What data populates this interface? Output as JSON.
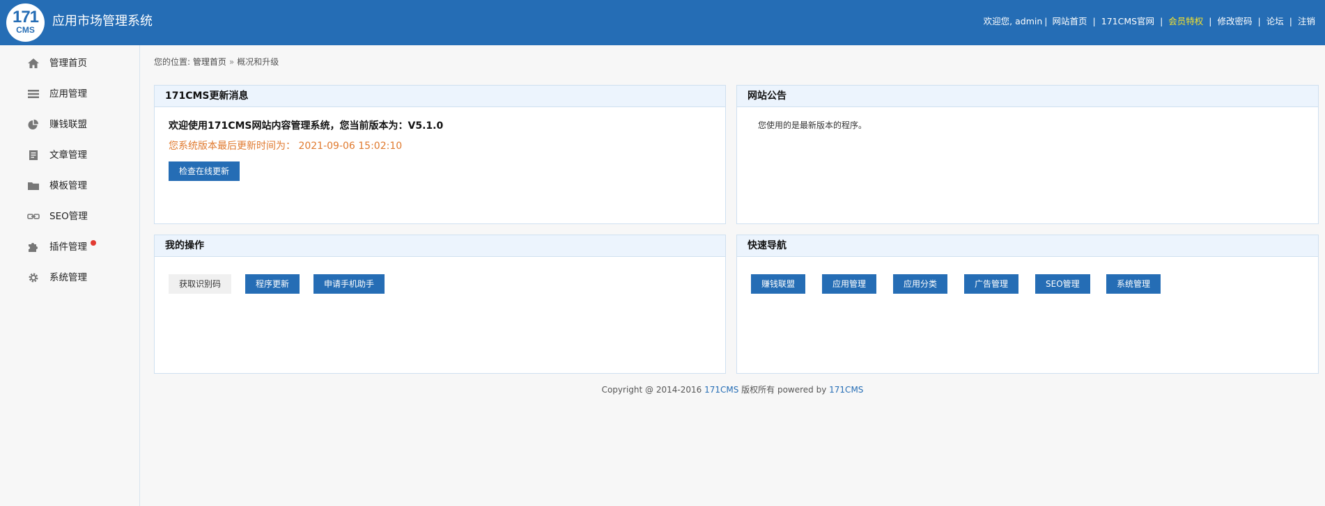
{
  "app": {
    "logo_line1": "171",
    "logo_line2": "CMS",
    "title": "应用市场管理系统"
  },
  "top_nav": {
    "welcome": "欢迎您, admin",
    "site_home": "网站首页",
    "official_site": "171CMS官网",
    "vip": "会员特权",
    "change_password": "修改密码",
    "forum": "论坛",
    "logout": "注销",
    "separator": "|"
  },
  "sidebar": {
    "items": [
      {
        "label": "管理首页",
        "icon": "home-icon"
      },
      {
        "label": "应用管理",
        "icon": "list-icon"
      },
      {
        "label": "赚钱联盟",
        "icon": "pie-chart-icon"
      },
      {
        "label": "文章管理",
        "icon": "document-icon"
      },
      {
        "label": "模板管理",
        "icon": "folder-icon"
      },
      {
        "label": "SEO管理",
        "icon": "link-icon"
      },
      {
        "label": "插件管理",
        "icon": "puzzle-icon",
        "badge": true
      },
      {
        "label": "系统管理",
        "icon": "gear-icon"
      }
    ]
  },
  "breadcrumb": {
    "prefix": "您的位置:",
    "home": "管理首页",
    "separator": "»",
    "current": "概况和升级"
  },
  "panels": {
    "update": {
      "title": "171CMS更新消息",
      "welcome": "欢迎使用171CMS网站内容管理系统，您当前版本为：V5.1.0",
      "last_update": "您系统版本最后更新时间为：  2021-09-06 15:02:10",
      "check_button": "检查在线更新"
    },
    "announcement": {
      "title": "网站公告",
      "text": "您使用的是最新版本的程序。"
    },
    "my_ops": {
      "title": "我的操作",
      "buttons": [
        "获取识别码",
        "程序更新",
        "申请手机助手"
      ]
    },
    "quick_nav": {
      "title": "快速导航",
      "buttons": [
        "赚钱联盟",
        "应用管理",
        "应用分类",
        "广告管理",
        "SEO管理",
        "系统管理"
      ]
    }
  },
  "footer": {
    "prefix": "Copyright @ 2014-2016 ",
    "brand": "171CMS",
    "middle": " 版权所有 powered by ",
    "brand2": "171CMS"
  },
  "colors": {
    "header_bg": "#256db5",
    "accent": "#256db5",
    "vip": "#f6e32c",
    "update_time": "#e07a2f",
    "badge": "#e23b32",
    "panel_header_bg": "#ecf4fd"
  }
}
